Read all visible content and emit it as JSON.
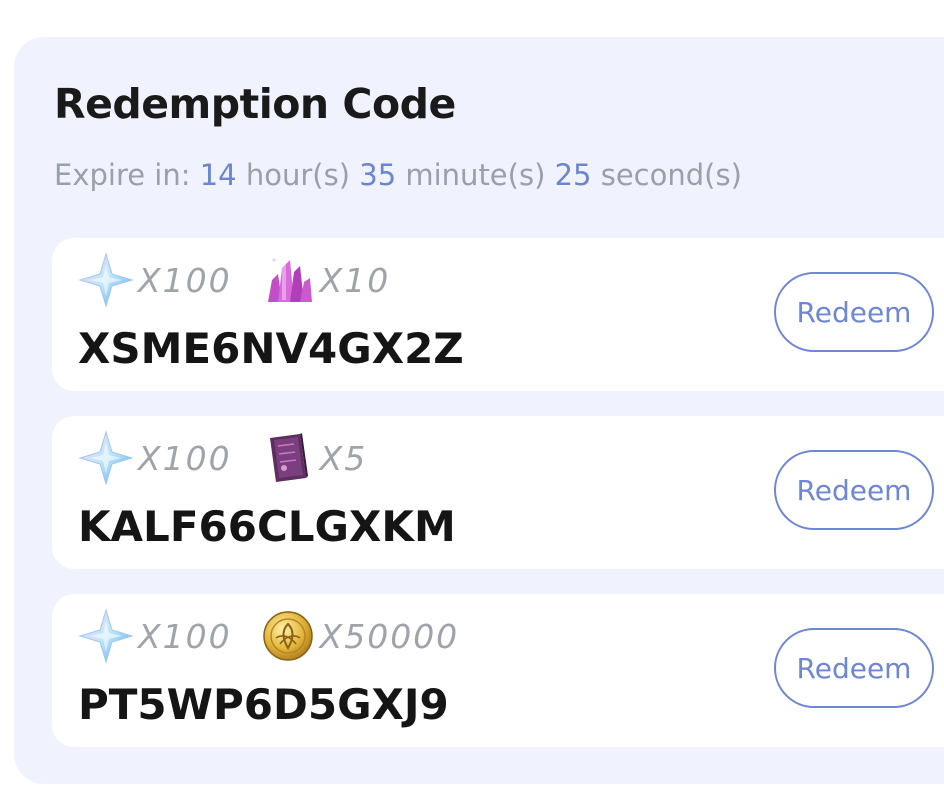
{
  "title": "Redemption Code",
  "expire": {
    "label": "Expire in:",
    "hours": "14",
    "hours_unit": "hour(s)",
    "minutes": "35",
    "minutes_unit": "minute(s)",
    "seconds": "25",
    "seconds_unit": "second(s)"
  },
  "codes": [
    {
      "code": "XSME6NV4GX2Z",
      "button": "Redeem",
      "rewards": [
        {
          "icon": "primogem-icon",
          "qty": "X100"
        },
        {
          "icon": "crystal-ore-icon",
          "qty": "X10"
        }
      ]
    },
    {
      "code": "KALF66CLGXKM",
      "button": "Redeem",
      "rewards": [
        {
          "icon": "primogem-icon",
          "qty": "X100"
        },
        {
          "icon": "talent-book-icon",
          "qty": "X5"
        }
      ]
    },
    {
      "code": "PT5WP6D5GXJ9",
      "button": "Redeem",
      "rewards": [
        {
          "icon": "primogem-icon",
          "qty": "X100"
        },
        {
          "icon": "mora-coin-icon",
          "qty": "X50000"
        }
      ]
    }
  ],
  "colors": {
    "accent": "#6f86d2",
    "card_bg": "#f0f3fd",
    "muted_text": "#9aa0a8"
  }
}
